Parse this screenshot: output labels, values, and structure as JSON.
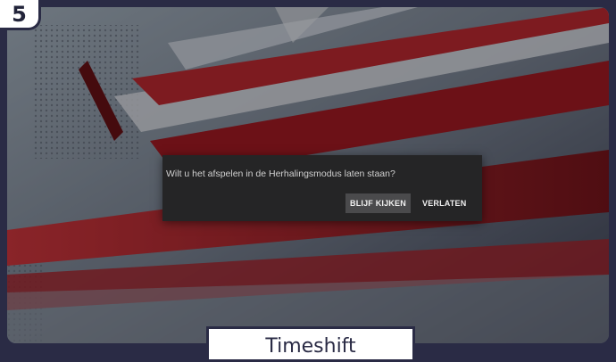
{
  "step": {
    "number": "5"
  },
  "dialog": {
    "message": "Wilt u het afspelen in de Herhalingsmodus laten staan?",
    "buttons": {
      "stay": "BLIJF KIJKEN",
      "leave": "VERLATEN"
    }
  },
  "caption": {
    "label": "Timeshift"
  },
  "colors": {
    "frame": "#2a2b45",
    "dialog_bg": "#252526",
    "accent_red": "#c0222a"
  }
}
